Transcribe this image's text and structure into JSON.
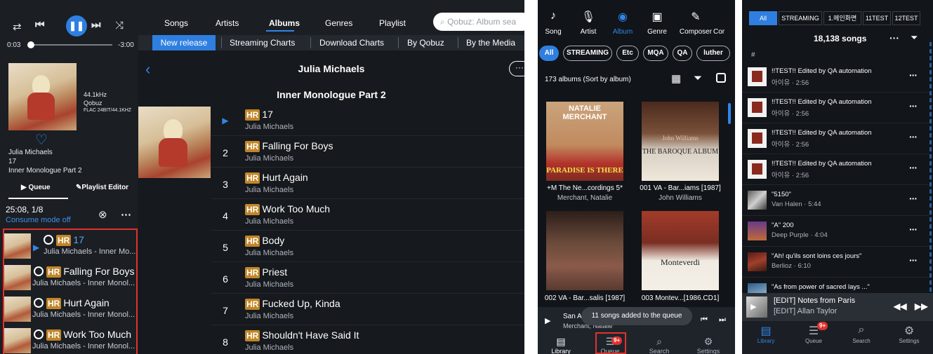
{
  "tablet": {
    "player": {
      "time_elapsed": "0:03",
      "time_remaining": "-3:00",
      "progress": 0.02,
      "quality": [
        "44.1kHz",
        "Qobuz",
        "FLAC 24BIT/44.1KHZ"
      ],
      "artist": "Julia Michaels",
      "track_no": "17",
      "album": "Inner Monologue Part 2",
      "queue_tab": "Queue",
      "playlist_editor_tab": "Playlist Editor",
      "queue_status": "25:08, 1/8",
      "consume_mode": "Consume mode off"
    },
    "queue": [
      {
        "title": "17",
        "sub": "Julia Michaels - Inner Mo...",
        "playing": true
      },
      {
        "title": "Falling For Boys",
        "sub": "Julia Michaels - Inner Monol...",
        "playing": false
      },
      {
        "title": "Hurt Again",
        "sub": "Julia Michaels - Inner Monol...",
        "playing": false
      },
      {
        "title": "Work Too Much",
        "sub": "Julia Michaels - Inner Monol...",
        "playing": false
      }
    ],
    "nav_tabs": [
      "Songs",
      "Artists",
      "Albums",
      "Genres",
      "Playlist"
    ],
    "active_nav": "Albums",
    "search_placeholder": "Qobuz: Album sea",
    "sub_tabs": [
      "New release",
      "Streaming Charts",
      "Download Charts",
      "By Qobuz",
      "By the Media"
    ],
    "active_sub": "New release",
    "artist_header": "Julia Michaels",
    "album_header": "Inner Monologue Part 2",
    "hr_badge": "HR",
    "tracks": [
      {
        "num": "",
        "title": "17",
        "artist": "Julia Michaels",
        "playing": true
      },
      {
        "num": "2",
        "title": "Falling For Boys",
        "artist": "Julia Michaels"
      },
      {
        "num": "3",
        "title": "Hurt Again",
        "artist": "Julia Michaels"
      },
      {
        "num": "4",
        "title": "Work Too Much",
        "artist": "Julia Michaels"
      },
      {
        "num": "5",
        "title": "Body",
        "artist": "Julia Michaels"
      },
      {
        "num": "6",
        "title": "Priest",
        "artist": "Julia Michaels"
      },
      {
        "num": "7",
        "title": "Fucked Up, Kinda",
        "artist": "Julia Michaels"
      },
      {
        "num": "8",
        "title": "Shouldn't Have Said It",
        "artist": "Julia Michaels"
      }
    ]
  },
  "phone_albums": {
    "tabs": [
      "Song",
      "Artist",
      "Album",
      "Genre",
      "Composer",
      "Cor"
    ],
    "tab_icons": [
      "note-icon",
      "mic-icon",
      "disc-icon",
      "genre-icon",
      "composer-icon",
      ""
    ],
    "active_tab": "Album",
    "chips": [
      "All",
      "STREAMING",
      "Etc",
      "MQA",
      "QA",
      "luther"
    ],
    "active_chip": "All",
    "count": "173 albums (Sort by album)",
    "albums": [
      {
        "caption": "+M The Ne...cordings 5*",
        "artist": "Merchant, Natalie",
        "cover_top": "NATALIE MERCHANT",
        "cover_bottom": "PARADISE IS THERE"
      },
      {
        "caption": "001 VA - Bar...iams [1987]",
        "artist": "John Williams",
        "cover_top": "John Williams",
        "cover_bottom": "THE BAROQUE ALBUM"
      },
      {
        "caption": "002 VA - Bar...salis [1987]",
        "artist": "",
        "cover_top": "",
        "cover_bottom": ""
      },
      {
        "caption": "003 Montev...[1986.CD1]",
        "artist": "",
        "cover_top": "",
        "cover_bottom": "Monteverdi"
      }
    ],
    "mini_player": {
      "title": "San Andr",
      "artist": "Merchant, Natalie"
    },
    "toast": "11 songs added to the queue",
    "bottom_nav": [
      "Library",
      "Queue",
      "Search",
      "Settings"
    ],
    "queue_badge": "9+"
  },
  "phone_songs": {
    "tabs": [
      "All",
      "STREAMING",
      "1.메인화면",
      "11TEST",
      "12TEST"
    ],
    "active_tab": "All",
    "songs_count": "18,138 songs",
    "index_letter": "#",
    "songs": [
      {
        "title": "!!TEST!! Edited by QA automation",
        "sub": "아이유 · 2:56"
      },
      {
        "title": "!!TEST!! Edited by QA automation",
        "sub": "아이유 · 2:56"
      },
      {
        "title": "!!TEST!! Edited by QA automation",
        "sub": "아이유 · 2:56"
      },
      {
        "title": "!!TEST!! Edited by QA automation",
        "sub": "아이유 · 2:56"
      },
      {
        "title": "\"5150\"",
        "sub": "Van Halen · 5:44"
      },
      {
        "title": "\"A\" 200",
        "sub": "Deep Purple · 4:04"
      },
      {
        "title": "\"Ah! qu'ils sont loins ces jours\"",
        "sub": "Berlioz · 6:10"
      },
      {
        "title": "\"As from power of sacred lays ...\"",
        "sub": ""
      }
    ],
    "mini_player": {
      "title": "[EDIT] Notes from Paris",
      "artist": "[EDIT] Allan Taylor"
    },
    "bottom_nav": [
      "Library",
      "Queue",
      "Search",
      "Settings"
    ],
    "queue_badge": "9+"
  }
}
